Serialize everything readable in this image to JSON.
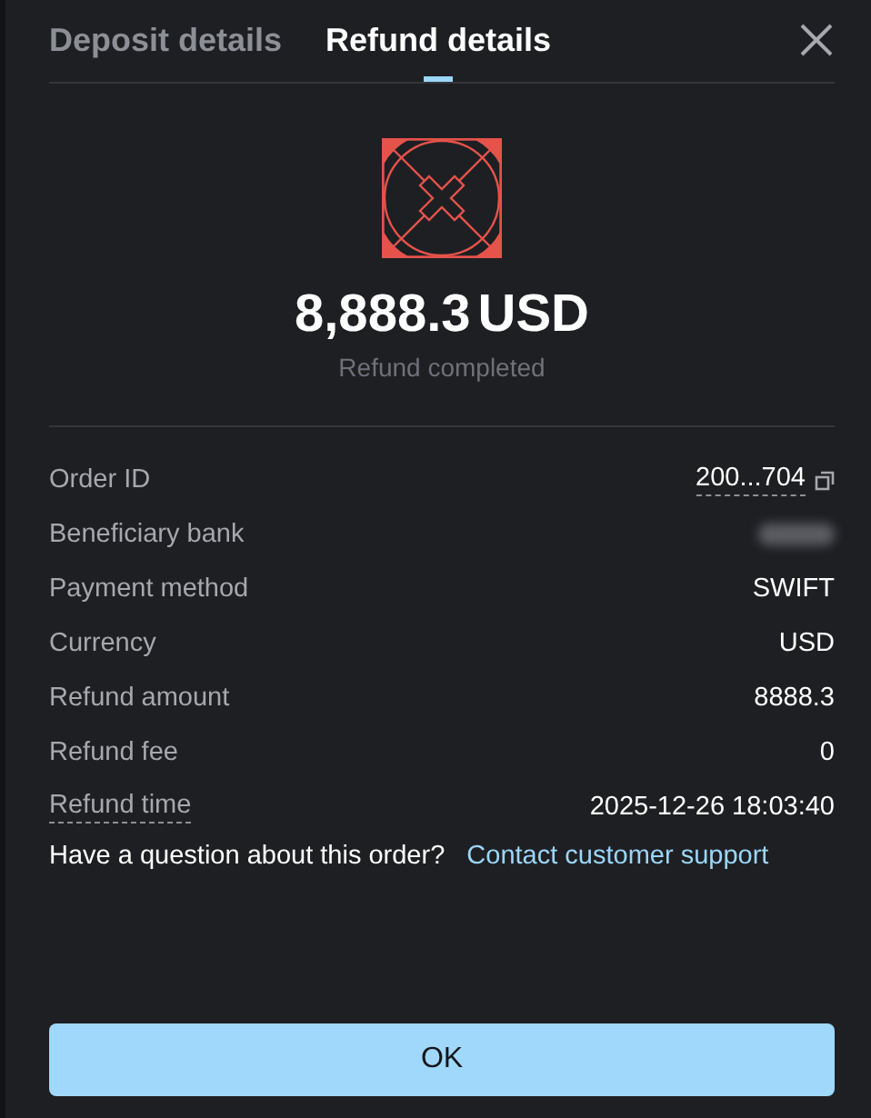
{
  "tabs": [
    {
      "label": "Deposit details",
      "selected": false
    },
    {
      "label": "Refund details",
      "selected": true
    }
  ],
  "summary": {
    "amount": "8,888.3",
    "currency": "USD",
    "status": "Refund completed"
  },
  "rows": [
    {
      "label": "Order ID",
      "label_underlined": false,
      "kind": "copy",
      "value": "200...704"
    },
    {
      "label": "Beneficiary bank",
      "label_underlined": false,
      "kind": "hidden"
    },
    {
      "label": "Payment method",
      "label_underlined": false,
      "kind": "plain",
      "value": "SWIFT"
    },
    {
      "label": "Currency",
      "label_underlined": false,
      "kind": "plain",
      "value": "USD"
    },
    {
      "label": "Refund amount",
      "label_underlined": false,
      "kind": "plain",
      "value": "8888.3"
    },
    {
      "label": "Refund fee",
      "label_underlined": false,
      "kind": "plain",
      "value": "0"
    },
    {
      "label": "Refund time",
      "label_underlined": true,
      "kind": "plain",
      "value": "2025-12-26 18:03:40"
    }
  ],
  "help": {
    "question": "Have a question about this order?",
    "link": "Contact customer support"
  },
  "buttons": [
    "OK"
  ]
}
